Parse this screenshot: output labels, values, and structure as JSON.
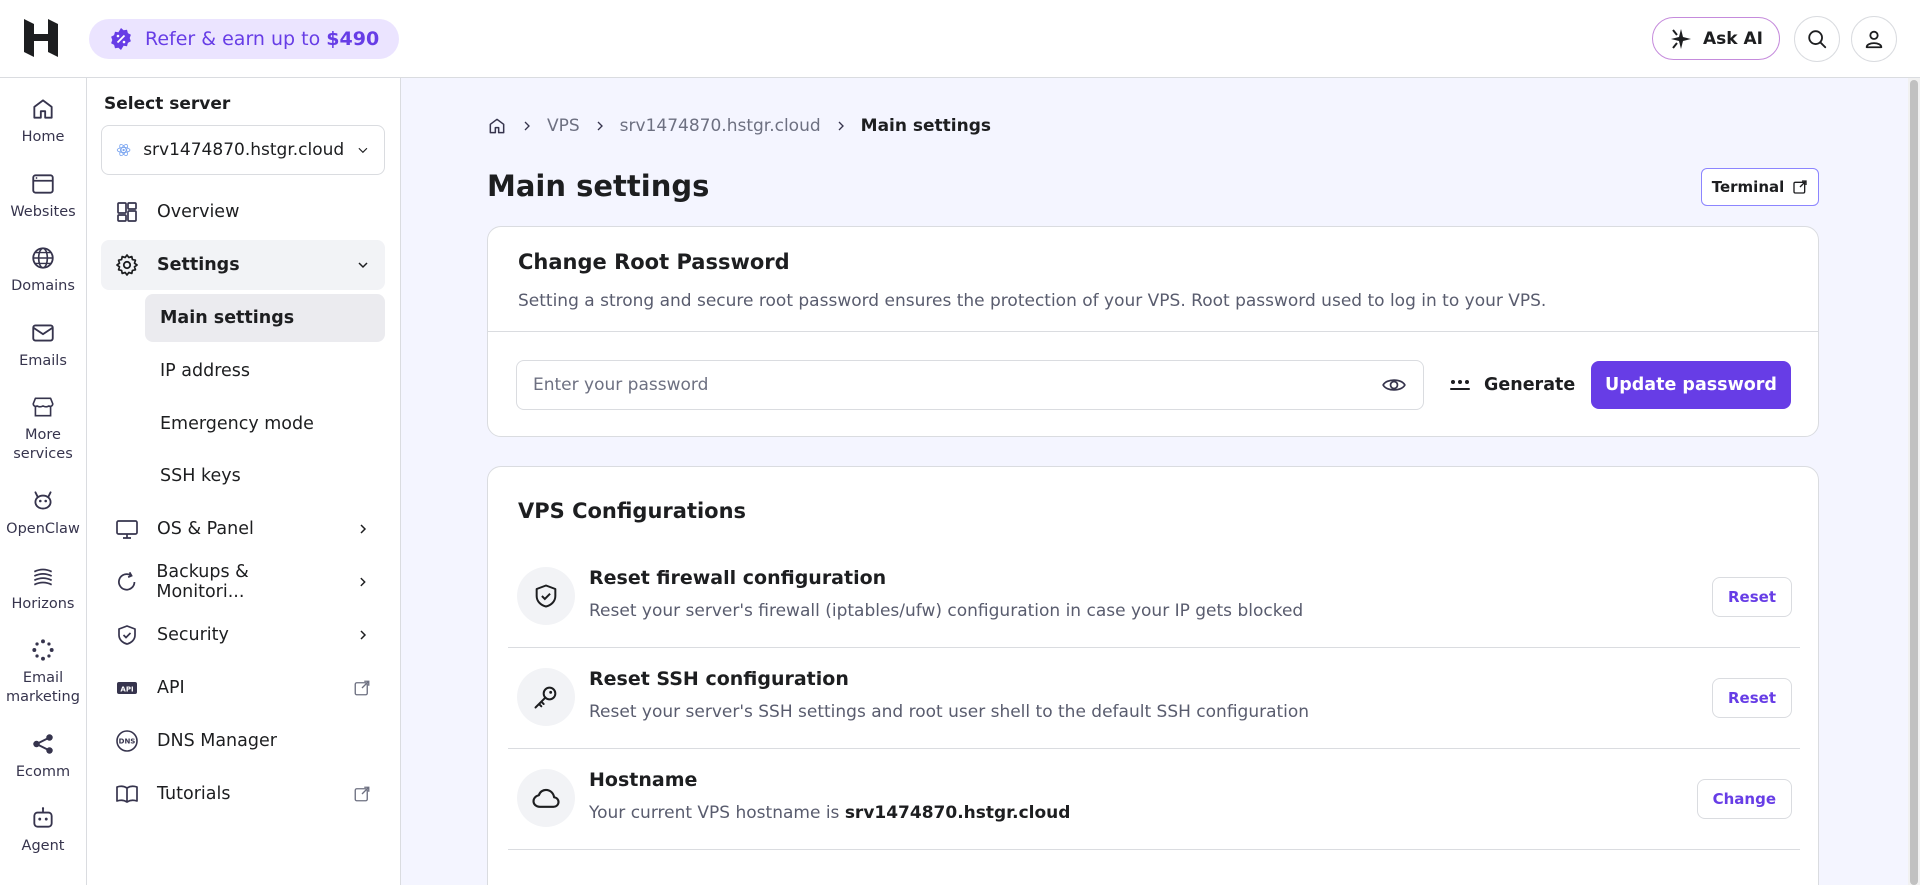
{
  "topbar": {
    "refer_text": "Refer & earn up to",
    "refer_amount": "$490",
    "ask_ai": "Ask AI"
  },
  "rail": {
    "items": [
      {
        "label": "Home",
        "icon": "home-icon"
      },
      {
        "label": "Websites",
        "icon": "browser-icon"
      },
      {
        "label": "Domains",
        "icon": "globe-icon"
      },
      {
        "label": "Emails",
        "icon": "mail-icon"
      },
      {
        "label": "More services",
        "icon": "store-icon"
      },
      {
        "label": "OpenClaw",
        "icon": "claw-icon"
      },
      {
        "label": "Horizons",
        "icon": "horizons-icon"
      },
      {
        "label": "Email marketing",
        "icon": "email-marketing-icon"
      },
      {
        "label": "Ecomm",
        "icon": "share-icon"
      },
      {
        "label": "Agent",
        "icon": "robot-icon"
      }
    ]
  },
  "sidebar": {
    "select_label": "Select server",
    "server_name": "srv1474870.hstgr.cloud",
    "overview": "Overview",
    "settings": "Settings",
    "sub_items": [
      "Main settings",
      "IP address",
      "Emergency mode",
      "SSH keys"
    ],
    "os_panel": "OS & Panel",
    "backups": "Backups & Monitori...",
    "security": "Security",
    "api": "API",
    "dns": "DNS Manager",
    "tutorials": "Tutorials"
  },
  "breadcrumb": {
    "vps": "VPS",
    "server": "srv1474870.hstgr.cloud",
    "current": "Main settings"
  },
  "page": {
    "title": "Main settings",
    "terminal": "Terminal"
  },
  "root_password": {
    "title": "Change Root Password",
    "description": "Setting a strong and secure root password ensures the protection of your VPS. Root password used to log in to your VPS.",
    "placeholder": "Enter your password",
    "generate": "Generate",
    "update": "Update password"
  },
  "vps_config": {
    "title": "VPS Configurations",
    "rows": [
      {
        "title": "Reset firewall configuration",
        "description": "Reset your server's firewall (iptables/ufw) configuration in case your IP gets blocked",
        "action": "Reset"
      },
      {
        "title": "Reset SSH configuration",
        "description": "Reset your server's SSH settings and root user shell to the default SSH configuration",
        "action": "Reset"
      },
      {
        "title": "Hostname",
        "description": "Your current VPS hostname is",
        "value": "srv1474870.hstgr.cloud",
        "action": "Change"
      }
    ]
  },
  "colors": {
    "accent": "#673de6",
    "accent_light": "#ebe4ff",
    "border": "#dadce0",
    "page_bg": "#f4f5ff"
  }
}
